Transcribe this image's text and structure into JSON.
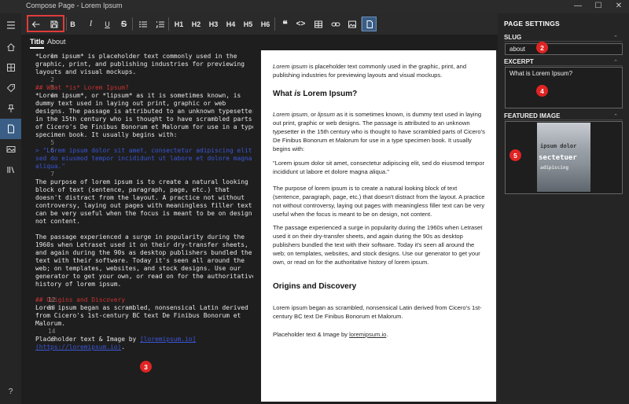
{
  "window": {
    "title": "Compose Page - Lorem Ipsum",
    "minimize": "—",
    "maximize": "☐",
    "close": "✕"
  },
  "sidebar": {
    "items": [
      "menu",
      "home",
      "pages",
      "tags",
      "pins",
      "compose",
      "gallery",
      "library"
    ],
    "help": "?"
  },
  "toolbar": {
    "back": "back-arrow",
    "save": "save",
    "bold": "B",
    "italic": "I",
    "underline": "U",
    "strike": "S",
    "h1": "H1",
    "h2": "H2",
    "h3": "H3",
    "h4": "H4",
    "h5": "H5",
    "h6": "H6",
    "quote": "❝",
    "code": "<>"
  },
  "tabs": {
    "title": "Title",
    "about": "About"
  },
  "badges": {
    "b1": "1",
    "b2": "2",
    "b3": "3",
    "b4": "4",
    "b5": "5"
  },
  "editor": {
    "lines": [
      {
        "n": "1",
        "text": "*Lorem ipsum* is placeholder text commonly used in the graphic, print, and publishing industries for previewing layouts and visual mockups."
      },
      {
        "n": "2",
        "text": ""
      },
      {
        "n": "3",
        "text": "## What *is* Lorem Ipsum?"
      },
      {
        "n": "4",
        "text": "*Lorem ipsum*, or *lipsum* as it is sometimes known, is dummy text used in laying out print, graphic or web designs. The passage is attributed to an unknown typesetter in the 15th century who is thought to have scrambled parts of Cicero's De Finibus Bonorum et Malorum for use in a type specimen book. It usually begins with:"
      },
      {
        "n": "5",
        "text": ""
      },
      {
        "n": "6",
        "text": "> \"Lorem ipsum dolor sit amet, consectetur adipiscing elit, sed do eiusmod tempor incididunt ut labore et dolore magna aliqua.\""
      },
      {
        "n": "7",
        "text": ""
      },
      {
        "n": "8",
        "text": "The purpose of lorem ipsum is to create a natural looking block of text (sentence, paragraph, page, etc.) that doesn't distract from the layout. A practice not without controversy, laying out pages with meaningless filler text can be very useful when the focus is meant to be on design, not content."
      },
      {
        "n": "9",
        "text": ""
      },
      {
        "n": "10",
        "text": "The passage experienced a surge in popularity during the 1960s when Letraset used it on their dry-transfer sheets, and again during the 90s as desktop publishers bundled the text with their software. Today it's seen all around the web; on templates, websites, and stock designs. Use our generator to get your own, or read on for the authoritative history of lorem ipsum."
      },
      {
        "n": "11",
        "text": ""
      },
      {
        "n": "12",
        "text": "## Origins and Discovery"
      },
      {
        "n": "13",
        "text": "Lorem ipsum began as scrambled, nonsensical Latin derived from Cicero's 1st-century BC text De Finibus Bonorum et Malorum."
      },
      {
        "n": "14",
        "text": ""
      },
      {
        "n": "15",
        "text_a": "Placeholder text & Image by ",
        "text_link": "[loremipsum.io](https://loremipsum.io)",
        "text_b": "."
      }
    ]
  },
  "preview": {
    "p1_em": "Lorem ipsum",
    "p1": " is placeholder text commonly used in the graphic, print, and publishing industries for previewing layouts and visual mockups.",
    "h_a": "What ",
    "h_em": "is",
    "h_b": " Lorem Ipsum?",
    "p2_em1": "Lorem ipsum",
    "p2_mid": ", or ",
    "p2_em2": "lipsum",
    "p2": " as it is sometimes known, is dummy text used in laying out print, graphic or web designs. The passage is attributed to an unknown typesetter in the 15th century who is thought to have scrambled parts of Cicero's De Finibus Bonorum et Malorum for use in a type specimen book. It usually begins with:",
    "quote": "\"Lorem ipsum dolor sit amet, consectetur adipiscing elit, sed do eiusmod tempor incididunt ut labore et dolore magna aliqua.\"",
    "p3": "The purpose of lorem ipsum is to create a natural looking block of text (sentence, paragraph, page, etc.) that doesn't distract from the layout. A practice not without controversy, laying out pages with meaningless filler text can be very useful when the focus is meant to be on design, not content.",
    "p4": "The passage experienced a surge in popularity during the 1960s when Letraset used it on their dry-transfer sheets, and again during the 90s as desktop publishers bundled the text with their software. Today it's seen all around the web; on templates, websites, and stock designs. Use our generator to get your own, or read on for the authoritative history of lorem ipsum.",
    "h2": "Origins and Discovery",
    "p5": "Lorem ipsum began as scrambled, nonsensical Latin derived from Cicero's 1st-century BC text De Finibus Bonorum et Malorum.",
    "p6": "Placeholder text & Image by ",
    "p6_link": "loremipsum.io",
    "p6_end": "."
  },
  "settings": {
    "title": "PAGE SETTINGS",
    "slug_label": "SLUG",
    "slug_value": "about",
    "excerpt_label": "EXCERPT",
    "excerpt_value": "What is Lorem Ipsum?",
    "image_label": "FEATURED IMAGE",
    "image_text": [
      "ipsum dolor",
      "sectetuer",
      "adipiscing"
    ],
    "chevron": "⌃"
  }
}
